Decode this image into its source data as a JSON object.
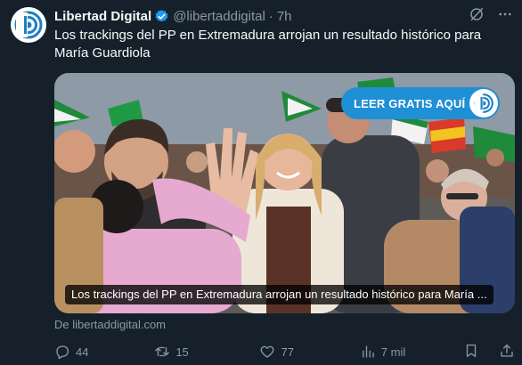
{
  "tweet": {
    "author_name": "Libertad Digital",
    "author_handle": "@libertaddigital",
    "separator": "·",
    "time": "7h",
    "text": "Los trackings del PP en Extremadura arrojan un resultado histórico para María Guardiola"
  },
  "card": {
    "promo_label": "LEER GRATIS AQUÍ",
    "caption": "Los trackings del PP en Extremadura arrojan un resultado histórico para María ...",
    "source": "De libertaddigital.com"
  },
  "actions": {
    "replies": "44",
    "retweets": "15",
    "likes": "77",
    "views": "7 mil"
  },
  "colors": {
    "background": "#15202b",
    "text": "#f7f9f9",
    "muted": "#8b98a5",
    "accent": "#1d9bf0",
    "verified": "#1d9bf0"
  },
  "icons": [
    "libertad-digital-logo",
    "verified-badge",
    "grok-icon",
    "more-icon",
    "reply-icon",
    "retweet-icon",
    "like-icon",
    "views-icon",
    "bookmark-icon",
    "share-icon"
  ]
}
